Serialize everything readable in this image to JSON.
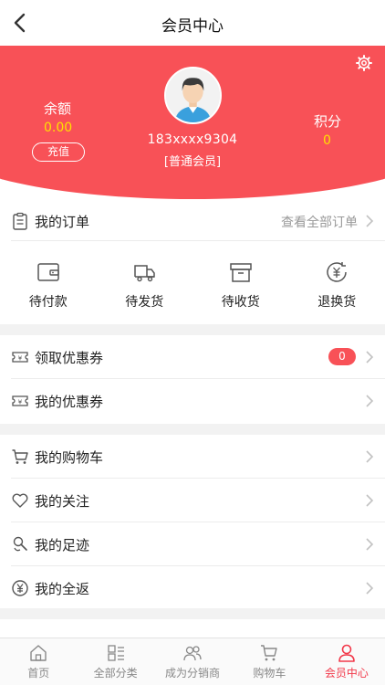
{
  "header": {
    "title": "会员中心"
  },
  "profile": {
    "balance_label": "余额",
    "balance_value": "0.00",
    "recharge_label": "充值",
    "phone": "183xxxx9304",
    "level": "[普通会员]",
    "points_label": "积分",
    "points_value": "0"
  },
  "orders": {
    "title": "我的订单",
    "view_all": "查看全部订单",
    "items": [
      {
        "label": "待付款",
        "icon": "wallet-icon"
      },
      {
        "label": "待发货",
        "icon": "truck-icon"
      },
      {
        "label": "待收货",
        "icon": "box-icon"
      },
      {
        "label": "退换货",
        "icon": "refund-icon"
      }
    ]
  },
  "coupons": {
    "get_label": "领取优惠券",
    "get_badge": "0",
    "mine_label": "我的优惠券"
  },
  "menu": {
    "cart": "我的购物车",
    "follow": "我的关注",
    "footprint": "我的足迹",
    "cashback": "我的全返"
  },
  "tabbar": {
    "items": [
      {
        "label": "首页"
      },
      {
        "label": "全部分类"
      },
      {
        "label": "成为分销商"
      },
      {
        "label": "购物车"
      },
      {
        "label": "会员中心"
      }
    ]
  },
  "colors": {
    "accent": "#f85157",
    "value_yellow": "#ffe000",
    "active_tab": "#f2394a"
  }
}
